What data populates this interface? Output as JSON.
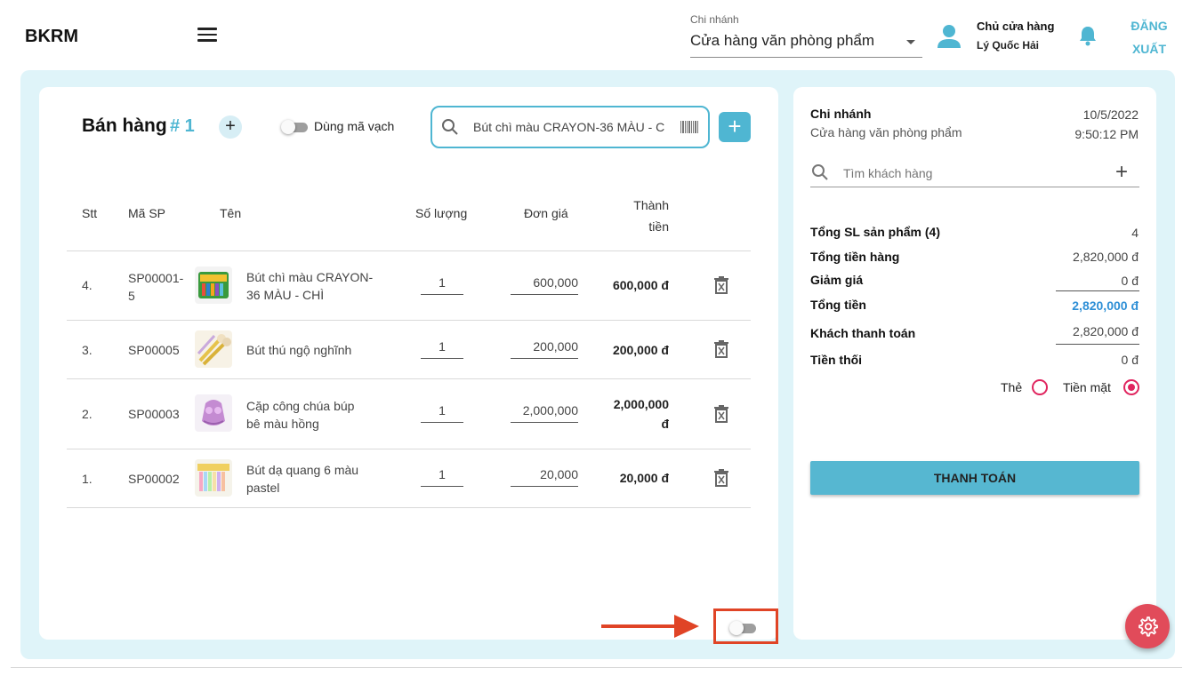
{
  "app": {
    "logo": "BKRM",
    "branch_label": "Chi nhánh",
    "branch_value": "Cửa hàng văn phòng phẩm",
    "user_role": "Chủ cửa hàng",
    "user_name": "Lý Quốc Hải",
    "logout_line1": "ĐĂNG",
    "logout_line2": "XUẤT"
  },
  "sale": {
    "title": "Bán hàng",
    "number": "# 1",
    "barcode_toggle_label": "Dùng mã vạch",
    "search_value": "Bút chì màu CRAYON-36 MÀU - C",
    "add_tab": "+",
    "add_product": "+"
  },
  "table": {
    "headers": {
      "stt": "Stt",
      "code": "Mã SP",
      "name": "Tên",
      "qty": "Số lượng",
      "price": "Đơn giá",
      "total_line1": "Thành",
      "total_line2": "tiền"
    },
    "rows": [
      {
        "stt": "4.",
        "code_line1": "SP00001-",
        "code_line2": "5",
        "name_line1": "Bút chì màu CRAYON-",
        "name_line2": "36 MÀU - CHÌ",
        "qty": "1",
        "price": "600,000",
        "total_line1": "600,000 đ",
        "total_line2": ""
      },
      {
        "stt": "3.",
        "code_line1": "SP00005",
        "code_line2": "",
        "name_line1": "Bút thú ngộ nghĩnh",
        "name_line2": "",
        "qty": "1",
        "price": "200,000",
        "total_line1": "200,000 đ",
        "total_line2": ""
      },
      {
        "stt": "2.",
        "code_line1": "SP00003",
        "code_line2": "",
        "name_line1": "Cặp công chúa búp",
        "name_line2": "bê màu hồng",
        "qty": "1",
        "price": "2,000,000",
        "total_line1": "2,000,000",
        "total_line2": "đ"
      },
      {
        "stt": "1.",
        "code_line1": "SP00002",
        "code_line2": "",
        "name_line1": "Bút dạ quang 6 màu",
        "name_line2": "pastel",
        "qty": "1",
        "price": "20,000",
        "total_line1": "20,000 đ",
        "total_line2": ""
      }
    ]
  },
  "summary": {
    "branch_label": "Chi nhánh",
    "branch_value": "Cửa hàng văn phòng phẩm",
    "date": "10/5/2022",
    "time": "9:50:12 PM",
    "customer_placeholder": "Tìm khách hàng",
    "customer_add": "+",
    "total_qty_label": "Tổng SL sản phẩm (4)",
    "total_qty_value": "4",
    "subtotal_label": "Tổng tiền hàng",
    "subtotal_value": "2,820,000 đ",
    "discount_label": "Giảm giá",
    "discount_value": "0 đ",
    "total_label": "Tổng tiền",
    "total_value": "2,820,000 đ",
    "paid_label": "Khách thanh toán",
    "paid_value": "2,820,000 đ",
    "change_label": "Tiền thối",
    "change_value": "0 đ",
    "method_card": "Thẻ",
    "method_cash": "Tiền mặt",
    "selected_method": "Tiền mặt",
    "pay_button": "THANH TOÁN"
  },
  "colors": {
    "accent": "#4fb6d2",
    "panel_bg": "#dff4f9",
    "fab": "#e14b5a",
    "annotation": "#e04426",
    "radio": "#e0245e"
  }
}
